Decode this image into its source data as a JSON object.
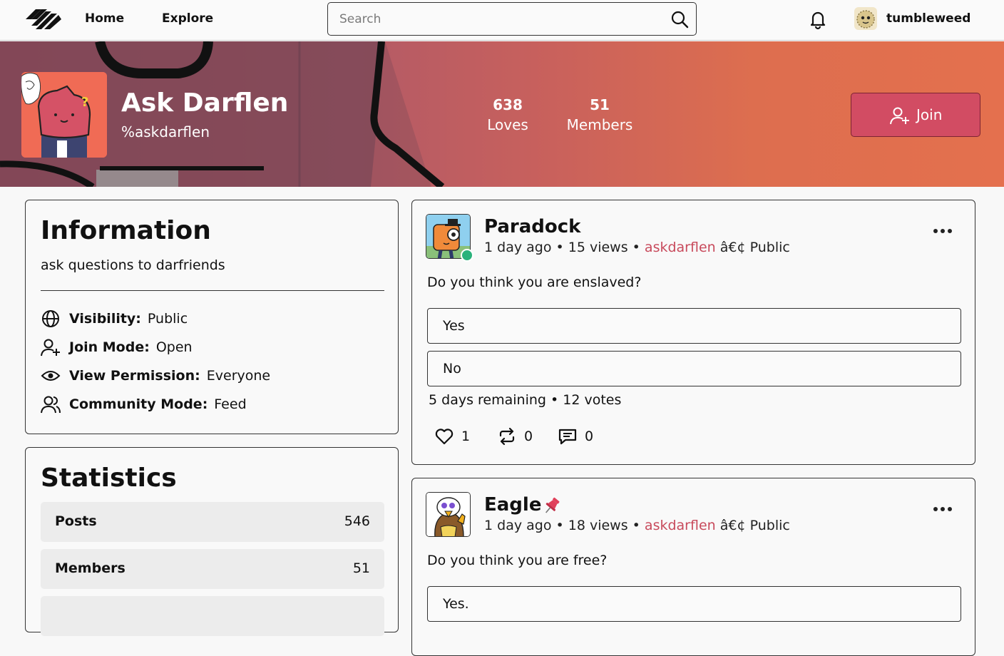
{
  "nav": {
    "home": "Home",
    "explore": "Explore",
    "search_placeholder": "Search",
    "username": "tumbleweed"
  },
  "community": {
    "name": "Ask Darflen",
    "handle": "%askdarflen",
    "loves_count": "638",
    "loves_label": "Loves",
    "members_count": "51",
    "members_label": "Members",
    "join_label": "Join"
  },
  "info": {
    "title": "Information",
    "description": "ask questions to darfriends",
    "rows": [
      {
        "key": "Visibility:",
        "value": "Public",
        "icon": "globe-icon"
      },
      {
        "key": "Join Mode:",
        "value": "Open",
        "icon": "user-plus-icon"
      },
      {
        "key": "View Permission:",
        "value": "Everyone",
        "icon": "eye-icon"
      },
      {
        "key": "Community Mode:",
        "value": "Feed",
        "icon": "users-icon"
      }
    ]
  },
  "statistics": {
    "title": "Statistics",
    "rows": [
      {
        "key": "Posts",
        "value": "546"
      },
      {
        "key": "Members",
        "value": "51"
      }
    ]
  },
  "posts": [
    {
      "author": "Paradock",
      "time": "1 day ago",
      "views": "15 views",
      "community": "askdarflen",
      "visibility_suffix": "â€¢ Public",
      "question": "Do you think you are enslaved?",
      "options": [
        "Yes",
        "No"
      ],
      "poll_info": "5 days remaining • 12 votes",
      "loves": "1",
      "reposts": "0",
      "comments": "0"
    },
    {
      "author": "Eagle",
      "time": "1 day ago",
      "views": "18 views",
      "community": "askdarflen",
      "visibility_suffix": "â€¢ Public",
      "question": "Do you think you are free?",
      "options": [
        "Yes."
      ]
    }
  ],
  "colors": {
    "accent": "#d24c63",
    "link": "#c84a5c",
    "online": "#2ab27b"
  }
}
